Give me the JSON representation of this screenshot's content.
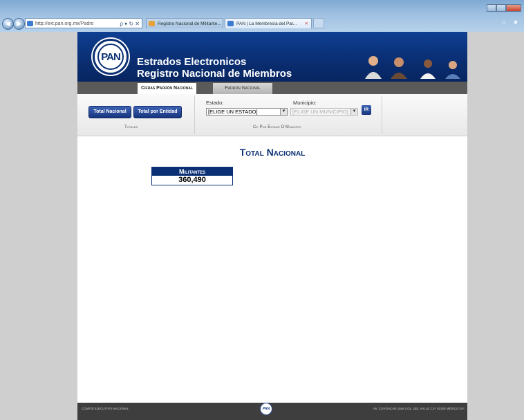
{
  "browser": {
    "address": "http://ext.pan.org.mx/Padro",
    "address_tools": "ρ ▾ ↻ ✕",
    "tabs": [
      {
        "label": "Registro Nacional de Militante..."
      },
      {
        "label": "PAN | La Membresía del Par...",
        "close": "✕"
      }
    ],
    "right_icons": "⌂ ★"
  },
  "header": {
    "logo_text": "PAN",
    "title_line1": "Estrados Electronicos",
    "title_line2": "Registro Nacional de Miembros",
    "tabs": [
      {
        "label": "Cifras Padrón Nacional",
        "active": true
      },
      {
        "label": "Padrón Nacional",
        "active": false
      }
    ]
  },
  "filters": {
    "btn_total_nacional": "Total Nacional",
    "btn_total_entidad": "Total por Entidad",
    "totales_label": "Totales",
    "estado_label": "Estado:",
    "estado_value": "[ELIGE UN ESTADO]",
    "municipio_label": "Municipio:",
    "municipio_value": "[ELIGE UN MUNICIPIO]",
    "ir_label": "IR",
    "by_estado_label": "Cif Por Estado O Municipio"
  },
  "content": {
    "title": "Total Nacional",
    "militantes_label": "Militantes",
    "militantes_value": "360,490"
  },
  "footer": {
    "left": "COMITÉ EJECUTIVO NACIONAL",
    "right": "AV. COYOACÁN 1546 COL. DEL VALLE C.P. 03100 MÉXICO D.F",
    "logo_text": "PAN"
  },
  "colors": {
    "brand_blue": "#0a2f74",
    "button_blue": "#17357d",
    "footer": "#3e3e3e"
  }
}
